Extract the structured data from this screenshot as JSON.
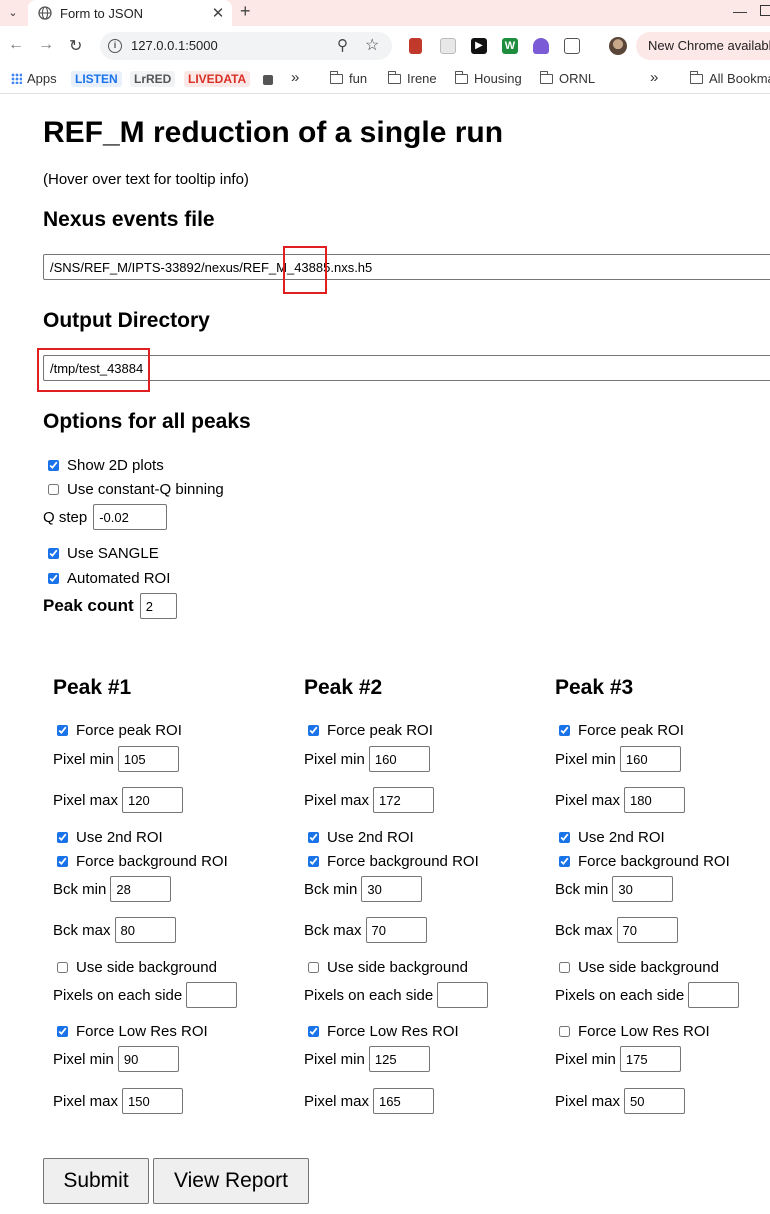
{
  "browser": {
    "tab_title": "Form to JSON",
    "url": "127.0.0.1:5000",
    "update_notice": "New Chrome available",
    "bookmarks": {
      "apps": "Apps",
      "listen": "LISTEN",
      "lrred": "LrRED",
      "livedata": "LIVEDATA",
      "overflow": "»",
      "fun": "fun",
      "irene": "Irene",
      "housing": "Housing",
      "ornl": "ORNL",
      "overflow2": "»",
      "all_bookmarks": "All Bookmarks"
    },
    "colors": {
      "tabstrip": "#fce8e6",
      "listen": "#1a73e8",
      "lrred": "#555555",
      "livedata": "#d93025"
    }
  },
  "form": {
    "title": "REF_M reduction of a single run",
    "hint": "(Hover over text for tooltip info)",
    "nexus_heading": "Nexus events file",
    "nexus_value": "/SNS/REF_M/IPTS-33892/nexus/REF_M_43885.nxs.h5",
    "output_heading": "Output Directory",
    "output_value": "/tmp/test_43884",
    "options_heading": "Options for all peaks",
    "show_2d_label": "Show 2D plots",
    "show_2d_checked": true,
    "const_q_label": "Use constant-Q binning",
    "const_q_checked": false,
    "q_step_label": "Q step",
    "q_step_value": "-0.02",
    "sangle_label": "Use SANGLE",
    "sangle_checked": true,
    "auto_roi_label": "Automated ROI",
    "auto_roi_checked": true,
    "peak_count_label": "Peak count",
    "peak_count_value": "2"
  },
  "labels": {
    "force_peak_roi": "Force peak ROI",
    "pixel_min": "Pixel min",
    "pixel_max": "Pixel max",
    "use_2nd_roi": "Use 2nd ROI",
    "force_bck_roi": "Force background ROI",
    "bck_min": "Bck min",
    "bck_max": "Bck max",
    "use_side_bck": "Use side background",
    "pixels_each_side": "Pixels on each side",
    "force_low_res": "Force Low Res ROI"
  },
  "peaks": [
    {
      "title": "Peak #1",
      "force_peak": true,
      "pixel_min": "105",
      "pixel_max": "120",
      "use_2nd_roi": true,
      "force_bck": true,
      "bck_min": "28",
      "bck_max": "80",
      "side_bck": false,
      "pixels_side": "",
      "force_low_res": true,
      "low_min": "90",
      "low_max": "150"
    },
    {
      "title": "Peak #2",
      "force_peak": true,
      "pixel_min": "160",
      "pixel_max": "172",
      "use_2nd_roi": true,
      "force_bck": true,
      "bck_min": "30",
      "bck_max": "70",
      "side_bck": false,
      "pixels_side": "",
      "force_low_res": true,
      "low_min": "125",
      "low_max": "165"
    },
    {
      "title": "Peak #3",
      "force_peak": true,
      "pixel_min": "160",
      "pixel_max": "180",
      "use_2nd_roi": true,
      "force_bck": true,
      "bck_min": "30",
      "bck_max": "70",
      "side_bck": false,
      "pixels_side": "",
      "force_low_res": false,
      "low_min": "175",
      "low_max": "50"
    }
  ],
  "buttons": {
    "submit": "Submit",
    "view_report": "View Report"
  }
}
